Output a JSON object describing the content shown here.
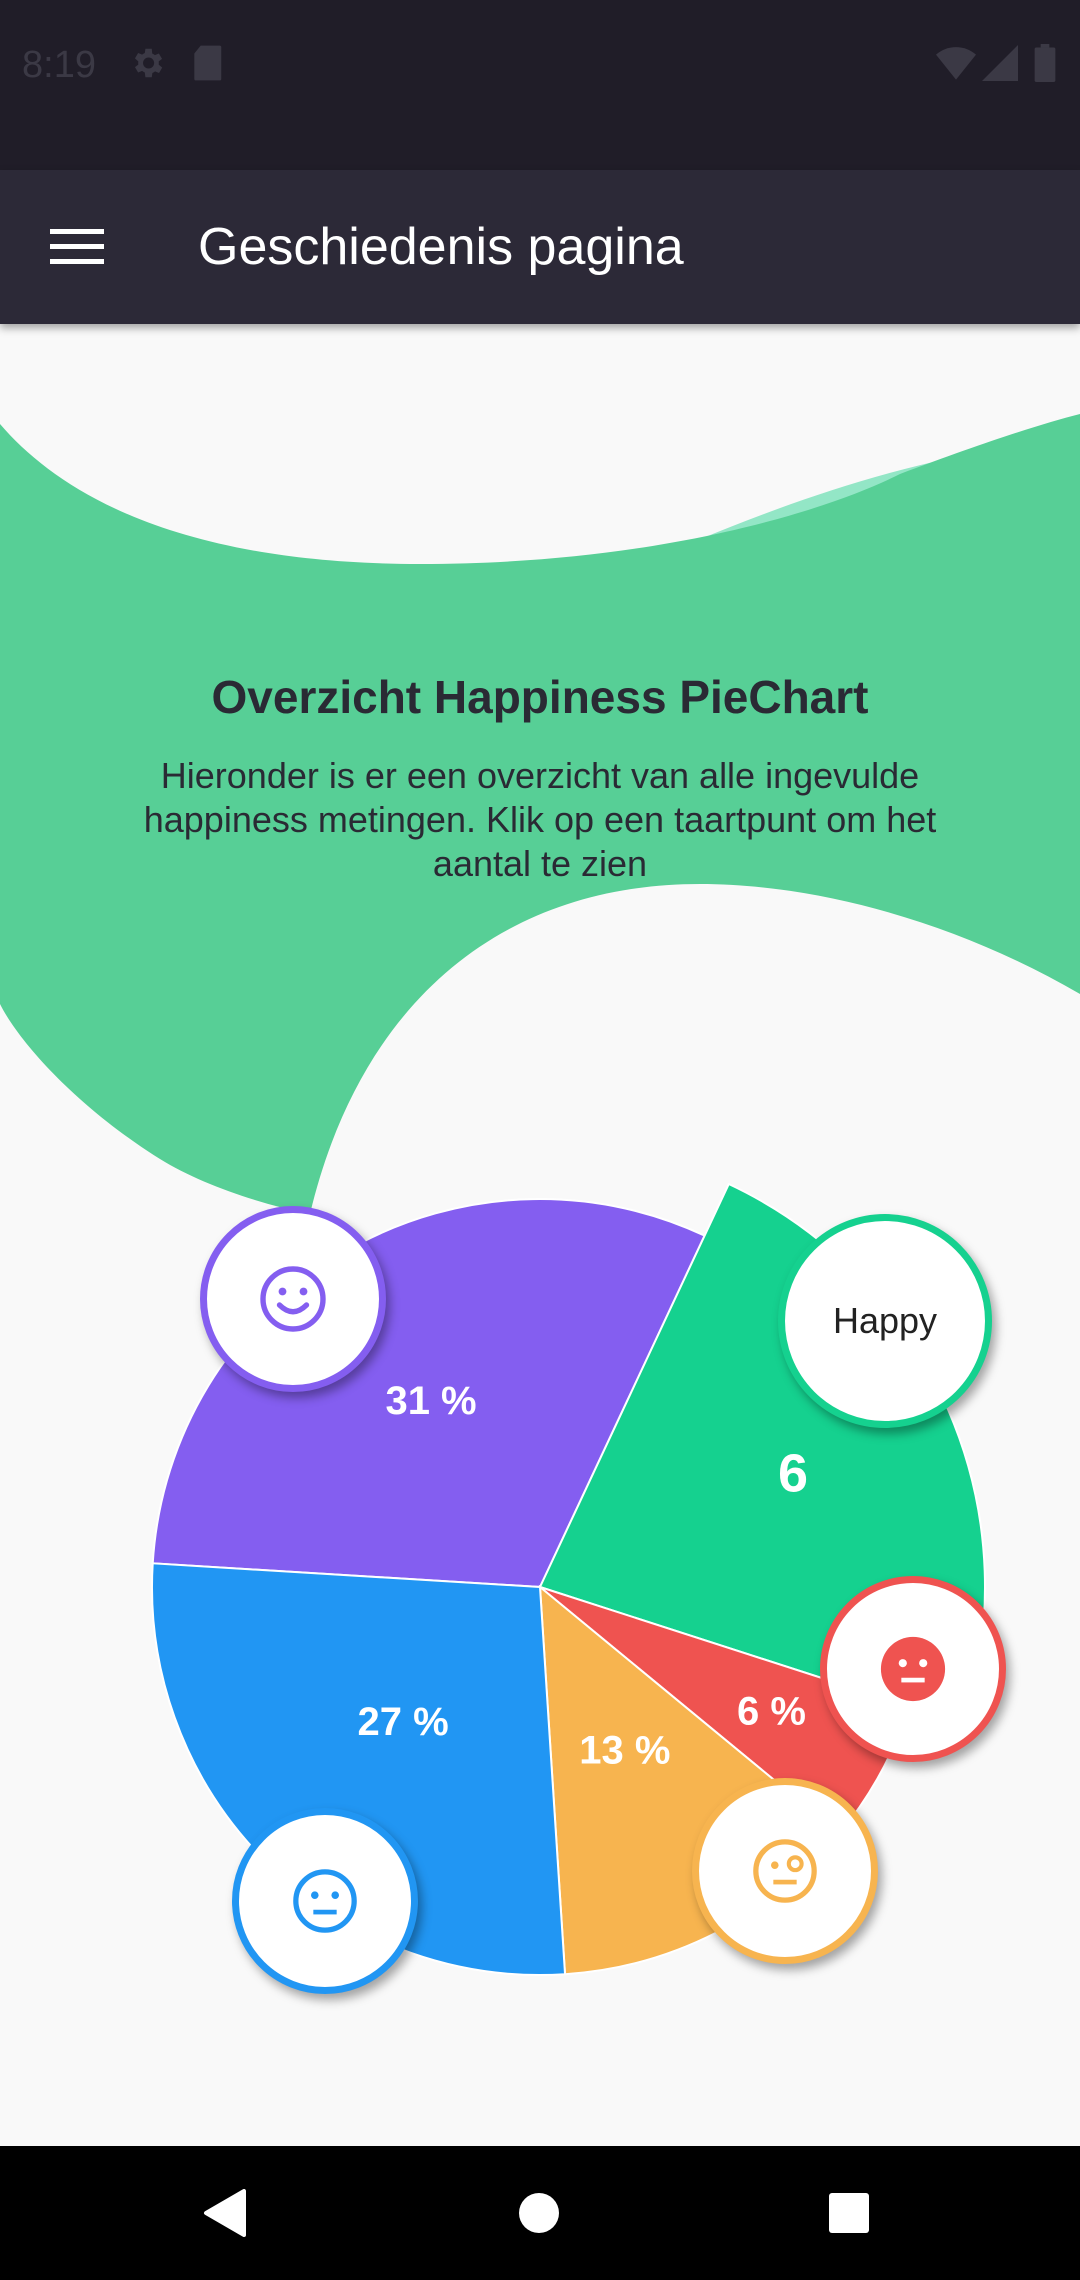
{
  "status_bar": {
    "time": "8:19",
    "left_icons": [
      "gear-icon",
      "sd-card-icon"
    ],
    "right_icons": [
      "wifi-icon",
      "signal-icon",
      "battery-icon"
    ]
  },
  "app_bar": {
    "menu_icon": "hamburger-menu-icon",
    "title": "Geschiedenis pagina"
  },
  "overview": {
    "heading": "Overzicht Happiness PieChart",
    "description": "Hieronder is er een overzicht van alle ingevulde happiness metingen. Klik op een taartpunt om het aantal te zien"
  },
  "chart_data": {
    "type": "pie",
    "slices": [
      {
        "value": 31,
        "label": "31 %",
        "color": "#845ef0",
        "icon": "smile-icon"
      },
      {
        "value": 23,
        "label": "6",
        "color": "#15d18f",
        "badge_text": "Happy",
        "selected": true
      },
      {
        "value": 6,
        "label": "6 %",
        "color": "#ef5350",
        "icon": "sad-face-icon"
      },
      {
        "value": 13,
        "label": "13 %",
        "color": "#f7b44f",
        "icon": "confused-face-icon"
      },
      {
        "value": 27,
        "label": "27 %",
        "color": "#2196f3",
        "icon": "neutral-face-icon"
      }
    ]
  },
  "colors": {
    "wave_primary": "#57cf96",
    "wave_light": "#93e6c6",
    "app_bar": "#2c2937",
    "status_bar": "#201d28"
  },
  "nav_bar": {
    "buttons": [
      "back-icon",
      "home-icon",
      "recents-icon"
    ]
  }
}
